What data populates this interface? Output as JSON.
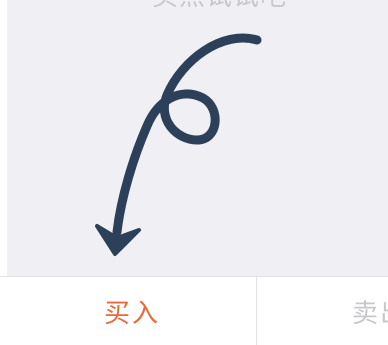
{
  "hint": {
    "text": "买点试试吧"
  },
  "guide": {
    "icon": "curly-arrow-down-icon",
    "color": "#2c4059"
  },
  "tabs": {
    "buy_label": "买入",
    "sell_label": "卖出",
    "active": "buy",
    "active_color": "#e8693a",
    "inactive_color": "#c8c8cc"
  },
  "colors": {
    "empty_background": "#efeff4",
    "tabbar_background": "#ffffff"
  }
}
